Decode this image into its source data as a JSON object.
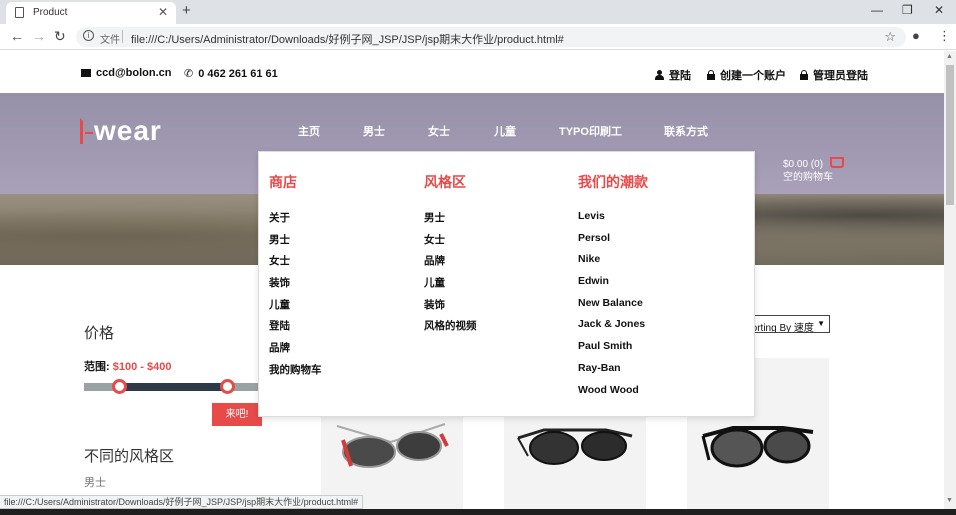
{
  "browser": {
    "tab_title": "Product",
    "new_tab": "+",
    "url_protocol": "文件",
    "url": "file:///C:/Users/Administrator/Downloads/好例子网_JSP/JSP/jsp期末大作业/product.html#",
    "status_url": "file:///C:/Users/Administrator/Downloads/好例子网_JSP/JSP/jsp期末大作业/product.html#"
  },
  "topbar": {
    "email": "ccd@bolon.cn",
    "phone": "0 462 261 61 61",
    "login": "登陆",
    "register": "创建一个账户",
    "admin_login": "管理员登陆"
  },
  "header": {
    "logo_text": "wear",
    "nav": [
      "主页",
      "男士",
      "女士",
      "儿童",
      "TYPO印刷工",
      "联系方式"
    ],
    "cart_amount": "$0.00 (0)",
    "cart_empty": "空的购物车"
  },
  "mega_menu": {
    "columns": [
      {
        "heading": "商店",
        "items": [
          "关于",
          "男士",
          "女士",
          "装饰",
          "儿童",
          "登陆",
          "品牌",
          "我的购物车"
        ]
      },
      {
        "heading": "风格区",
        "items": [
          "男士",
          "女士",
          "品牌",
          "儿童",
          "装饰",
          "风格的视频"
        ]
      },
      {
        "heading": "我们的潮款",
        "items": [
          "Levis",
          "Persol",
          "Nike",
          "Edwin",
          "New Balance",
          "Jack & Jones",
          "Paul Smith",
          "Ray-Ban",
          "Wood Wood"
        ]
      }
    ]
  },
  "sidebar": {
    "price_heading": "价格",
    "range_label": "范围:",
    "range_value": "$100 - $400",
    "go_button": "来吧!",
    "style_heading": "不同的风格区",
    "style_first_item": "男士"
  },
  "sort": {
    "selected": "Sorting By 速度"
  },
  "colors": {
    "accent": "#e84a4a",
    "hero": "#9d96ae",
    "dark": "#2f3a48"
  }
}
